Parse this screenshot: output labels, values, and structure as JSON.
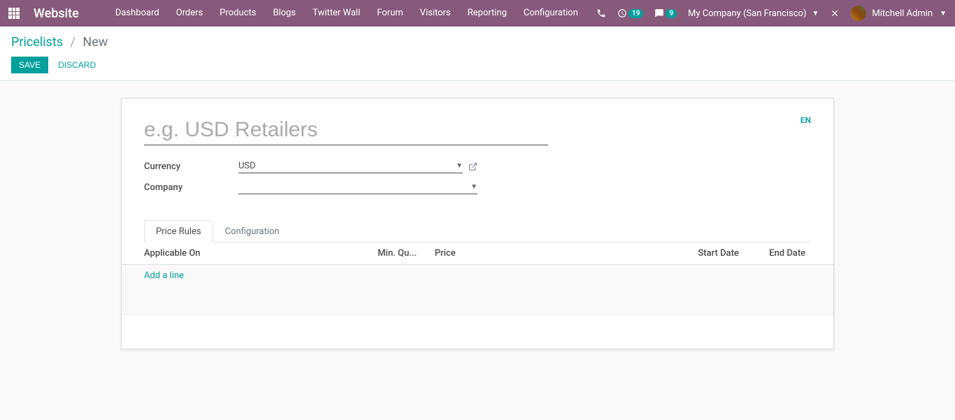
{
  "navbar": {
    "brand": "Website",
    "menu": [
      "Dashboard",
      "Orders",
      "Products",
      "Blogs",
      "Twitter Wall",
      "Forum",
      "Visitors",
      "Reporting",
      "Configuration"
    ],
    "activities_count": "19",
    "messages_count": "9",
    "company": "My Company (San Francisco)",
    "user": "Mitchell Admin"
  },
  "breadcrumb": {
    "parent": "Pricelists",
    "current": "New"
  },
  "buttons": {
    "save": "Save",
    "discard": "Discard"
  },
  "form": {
    "name_placeholder": "e.g. USD Retailers",
    "name_value": "",
    "lang": "EN",
    "currency_label": "Currency",
    "currency_value": "USD",
    "company_label": "Company",
    "company_value": ""
  },
  "tabs": {
    "price_rules": "Price Rules",
    "configuration": "Configuration"
  },
  "table": {
    "headers": {
      "applicable_on": "Applicable On",
      "min_quantity": "Min. Qu...",
      "price": "Price",
      "start_date": "Start Date",
      "end_date": "End Date"
    },
    "add_line": "Add a line"
  }
}
